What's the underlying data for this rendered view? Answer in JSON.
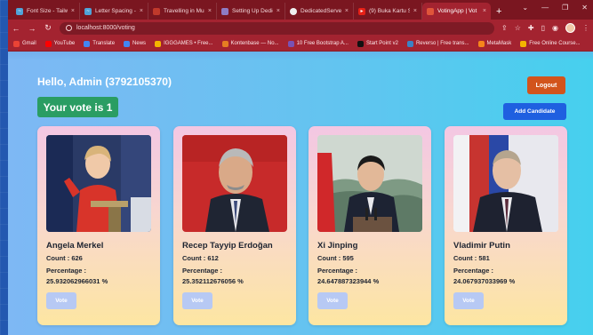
{
  "browser": {
    "tabs": [
      {
        "label": "Font Size - Tailwi",
        "icon_color": "#4fa3d8",
        "icon": "tailwind-icon"
      },
      {
        "label": "Letter Spacing -",
        "icon_color": "#4fa3d8",
        "icon": "tailwind-icon"
      },
      {
        "label": "Travelling in Mu",
        "icon_color": "#c0392b",
        "icon": "site-icon"
      },
      {
        "label": "Setting Up Dedic",
        "icon_color": "#8e7cc3",
        "icon": "site-icon"
      },
      {
        "label": "DedicatedServer",
        "icon_color": "#333333",
        "icon": "github-icon"
      },
      {
        "label": "(9) Buka Kartu S",
        "icon_color": "#e62117",
        "icon": "youtube-icon"
      },
      {
        "label": "VotingApp | Vot",
        "icon_color": "#e0553a",
        "icon": "app-icon"
      }
    ],
    "active_tab_index": 6,
    "close_glyph": "×",
    "new_tab_glyph": "+",
    "window_controls": [
      "⌄",
      "—",
      "❐",
      "✕"
    ],
    "url": "localhost:8000/voting",
    "nav": {
      "back": "←",
      "forward": "→",
      "reload": "↻"
    },
    "bookmarks": [
      {
        "label": "Gmail",
        "color": "#ea4335"
      },
      {
        "label": "YouTube",
        "color": "#ff0000"
      },
      {
        "label": "Translate",
        "color": "#4285f4"
      },
      {
        "label": "News",
        "color": "#4285f4"
      },
      {
        "label": "IGGGAMES • Free...",
        "color": "#f4b400"
      },
      {
        "label": "Kontenbase — No...",
        "color": "#e67e22"
      },
      {
        "label": "10 Free Bootstrap A...",
        "color": "#7952b3"
      },
      {
        "label": "Start Point v2",
        "color": "#111111"
      },
      {
        "label": "Reverso | Free trans...",
        "color": "#3b82c4"
      },
      {
        "label": "MetaMask",
        "color": "#f6851b"
      },
      {
        "label": "Free Online Course...",
        "color": "#f4b400"
      }
    ]
  },
  "app": {
    "greeting": "Hello, Admin (3792105370)",
    "logout_label": "Logout",
    "vote_status": "Your vote is 1",
    "add_candidate_label": "Add Candidate",
    "count_prefix": "Count : ",
    "percentage_label": "Percentage :",
    "vote_label": "Vote",
    "colors": {
      "logout": "#d2541c",
      "vote_badge": "#2a9d63",
      "add_candidate": "#1f5fe0",
      "vote_button": "#b7c9f4"
    },
    "candidates": [
      {
        "name": "Angela Merkel",
        "count": "Count : 626",
        "percentage": "25.932062966031 %"
      },
      {
        "name": "Recep Tayyip Erdoğan",
        "count": "Count : 612",
        "percentage": "25.352112676056 %"
      },
      {
        "name": "Xi Jinping",
        "count": "Count : 595",
        "percentage": "24.647887323944 %"
      },
      {
        "name": "Vladimir Putin",
        "count": "Count : 581",
        "percentage": "24.067937033969 %"
      }
    ]
  }
}
